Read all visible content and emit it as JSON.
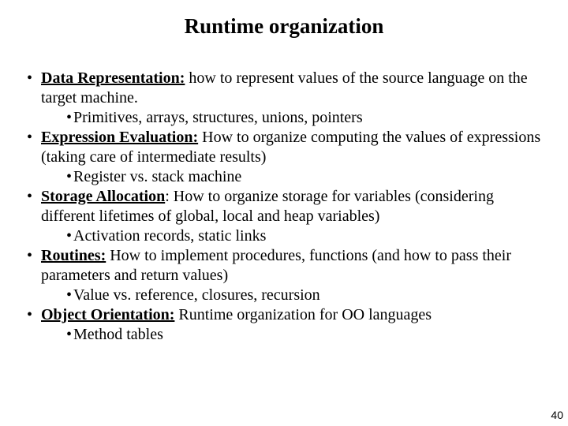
{
  "title": "Runtime organization",
  "items": [
    {
      "heading": "Data Representation:",
      "body": " how to represent values of the source language on the target machine.",
      "sub": "Primitives, arrays, structures, unions, pointers"
    },
    {
      "heading": "Expression Evaluation:",
      "body": " How to organize computing the values of expressions (taking care of intermediate results)",
      "sub": "Register vs. stack machine"
    },
    {
      "heading": "Storage Allocation",
      "body": ": How to organize storage for variables (considering different lifetimes of global, local and heap variables)",
      "sub": "Activation records, static links"
    },
    {
      "heading": "Routines:",
      "body": " How to implement procedures, functions (and how to pass their parameters and return values)",
      "sub": "Value vs. reference, closures, recursion"
    },
    {
      "heading": "Object Orientation:",
      "body": " Runtime organization for OO languages",
      "sub": "Method tables"
    }
  ],
  "page_number": "40",
  "bullet_char": "•",
  "sub_bullet_char": "•"
}
